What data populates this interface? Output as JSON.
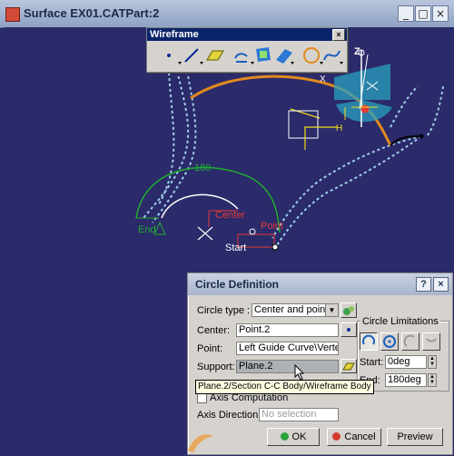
{
  "window": {
    "title": "Surface EX01.CATPart:2",
    "minimize_glyph": "_",
    "maximize_glyph": "□",
    "close_glyph": "×"
  },
  "toolbar": {
    "title": "Wireframe",
    "close_glyph": "×",
    "buttons": [
      "point-icon",
      "line-icon",
      "plane-icon",
      "projection-icon",
      "circle-icon",
      "spline-icon"
    ]
  },
  "scene": {
    "labels": {
      "arc_angle": "180",
      "center": "Center",
      "point": "Point",
      "start": "Start",
      "end": "End",
      "axis_z": "Z",
      "axis_x": "X",
      "axis_h": "H"
    }
  },
  "dialog": {
    "title": "Circle Definition",
    "help_glyph": "?",
    "close_glyph": "×",
    "circle_type_label": "Circle type :",
    "circle_type_value": "Center and point",
    "center_label": "Center:",
    "center_value": "Point.2",
    "point_label": "Point:",
    "point_value": "Left Guide Curve\\Verte",
    "support_label": "Support:",
    "support_value": "Plane.2",
    "tooltip": "Plane.2/Section C-C Body/Wireframe Body",
    "geometry_check_label": "G",
    "axis_computation_label": "Axis Computation",
    "axis_direction_label": "Axis Direction:",
    "axis_direction_placeholder": "No selection",
    "limitations": {
      "title": "Circle Limitations",
      "start_label": "Start:",
      "start_value": "0deg",
      "end_label": "End:",
      "end_value": "180deg"
    },
    "buttons": {
      "ok": "OK",
      "cancel": "Cancel",
      "preview": "Preview"
    }
  },
  "colors": {
    "background": "#2b2a6a",
    "highlight_orange": "#e08a1e",
    "arc_green": "#1fae2d",
    "guide_blue": "#9fd0e6",
    "label_red": "#e43b36",
    "axis_yellow": "#f3df1c"
  }
}
